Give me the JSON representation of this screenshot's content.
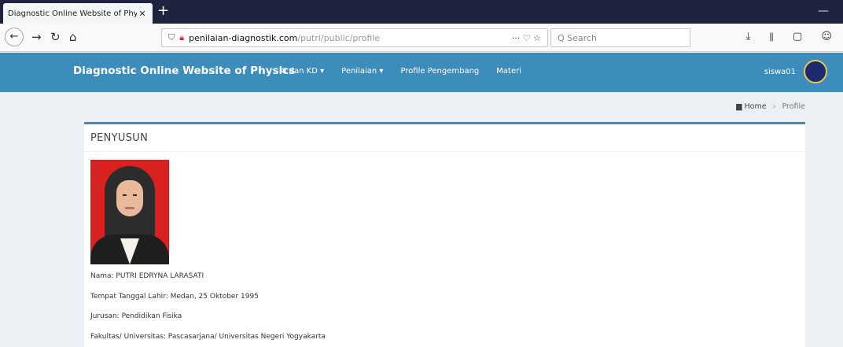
{
  "browser": {
    "tab_title": "Diagnostic Online Website of Phy:",
    "tab_close": "✕",
    "new_tab": "+",
    "url_host": "penilaian-diagnostik.com",
    "url_path": "/putri/public/profile",
    "url_actions": "···  ♡  ☆",
    "search_placeholder": "Q  Search",
    "toolbar_right": "⤓ ⫴ ▢ ☺"
  },
  "navbar": {
    "brand": "Diagnostic Online Website of Physics",
    "menu": [
      "KI dan KD ▾",
      "Penilaian ▾",
      "Profile Pengembang",
      "Materi"
    ],
    "user": "siswa01",
    "avatar_glyph": "UNY"
  },
  "breadcrumb": {
    "home": "Home",
    "current": "Profile"
  },
  "profile": {
    "section_title": "PENYUSUN",
    "name": "Nama: PUTRI EDRYNA LARASATI",
    "birth": "Tempat Tanggal Lahir: Medan, 25 Oktober 1995",
    "major": "Jurusan: Pendidikan Fisika",
    "faculty": "Fakultas/ Universitas: Pascasarjana/ Universitas Negeri Yogyakarta"
  },
  "colors": {
    "navbar": "#3c8dbc",
    "tabbar": "#20233f",
    "photo_bg": "#d9221f"
  }
}
